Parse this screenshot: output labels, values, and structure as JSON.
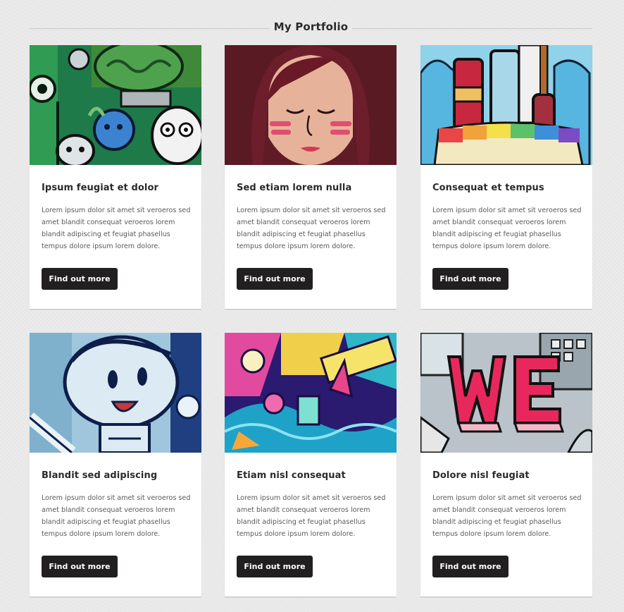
{
  "section": {
    "title": "My Portfolio"
  },
  "cards": [
    {
      "title": "Ipsum feugiat et dolor",
      "text": "Lorem ipsum dolor sit amet sit veroeros sed amet blandit consequat veroeros lorem blandit adipiscing et feugiat phasellus tempus dolore ipsum lorem dolore.",
      "button": "Find out more"
    },
    {
      "title": "Sed etiam lorem nulla",
      "text": "Lorem ipsum dolor sit amet sit veroeros sed amet blandit consequat veroeros lorem blandit adipiscing et feugiat phasellus tempus dolore ipsum lorem dolore.",
      "button": "Find out more"
    },
    {
      "title": "Consequat et tempus",
      "text": "Lorem ipsum dolor sit amet sit veroeros sed amet blandit consequat veroeros lorem blandit adipiscing et feugiat phasellus tempus dolore ipsum lorem dolore.",
      "button": "Find out more"
    },
    {
      "title": "Blandit sed adipiscing",
      "text": "Lorem ipsum dolor sit amet sit veroeros sed amet blandit consequat veroeros lorem blandit adipiscing et feugiat phasellus tempus dolore ipsum lorem dolore.",
      "button": "Find out more"
    },
    {
      "title": "Etiam nisl consequat",
      "text": "Lorem ipsum dolor sit amet sit veroeros sed amet blandit consequat veroeros lorem blandit adipiscing et feugiat phasellus tempus dolore ipsum lorem dolore.",
      "button": "Find out more"
    },
    {
      "title": "Dolore nisl feugiat",
      "text": "Lorem ipsum dolor sit amet sit veroeros sed amet blandit consequat veroeros lorem blandit adipiscing et feugiat phasellus tempus dolore ipsum lorem dolore.",
      "button": "Find out more"
    }
  ],
  "colors": {
    "background": "#ececec",
    "card": "#ffffff",
    "button": "#221f20",
    "button_text": "#ffffff",
    "heading": "#2a2a2a",
    "body_text": "#5a5a5a"
  }
}
